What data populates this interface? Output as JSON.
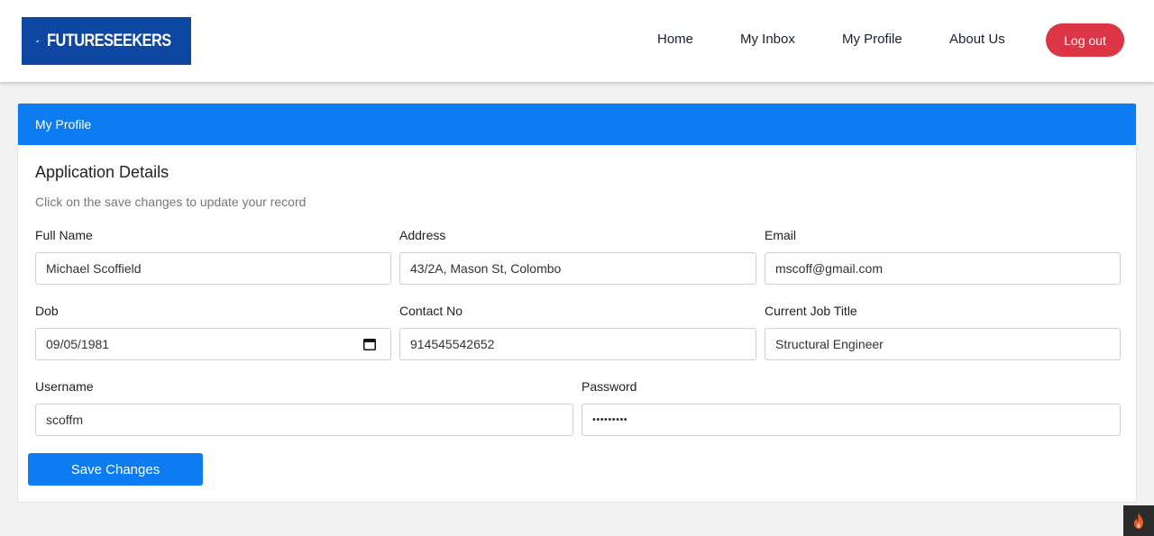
{
  "brand": {
    "name": "FUTURESEEKERS",
    "logo_icon": "paper-plane-icon",
    "color": "#0d47a1"
  },
  "nav": {
    "links": [
      "Home",
      "My Inbox",
      "My Profile",
      "About Us"
    ],
    "logout_label": "Log out",
    "logout_color": "#dc3545"
  },
  "card": {
    "header_title": "My Profile",
    "header_color": "#0d7cf2",
    "section_title": "Application Details",
    "section_subtitle": "Click on the save changes to update your record"
  },
  "form": {
    "full_name": {
      "label": "Full Name",
      "value": "Michael Scoffield"
    },
    "address": {
      "label": "Address",
      "value": "43/2A, Mason St, Colombo"
    },
    "email": {
      "label": "Email",
      "value": "mscoff@gmail.com"
    },
    "dob": {
      "label": "Dob",
      "value": "09/05/1981",
      "icon": "calendar-icon"
    },
    "contact_no": {
      "label": "Contact No",
      "value": "914545542652"
    },
    "job_title": {
      "label": "Current Job Title",
      "value": "Structural Engineer"
    },
    "username": {
      "label": "Username",
      "value": "scoffm"
    },
    "password": {
      "label": "Password",
      "value": "•••••••••"
    },
    "save_label": "Save Changes"
  },
  "corner_widget": {
    "icon": "flame-icon"
  }
}
